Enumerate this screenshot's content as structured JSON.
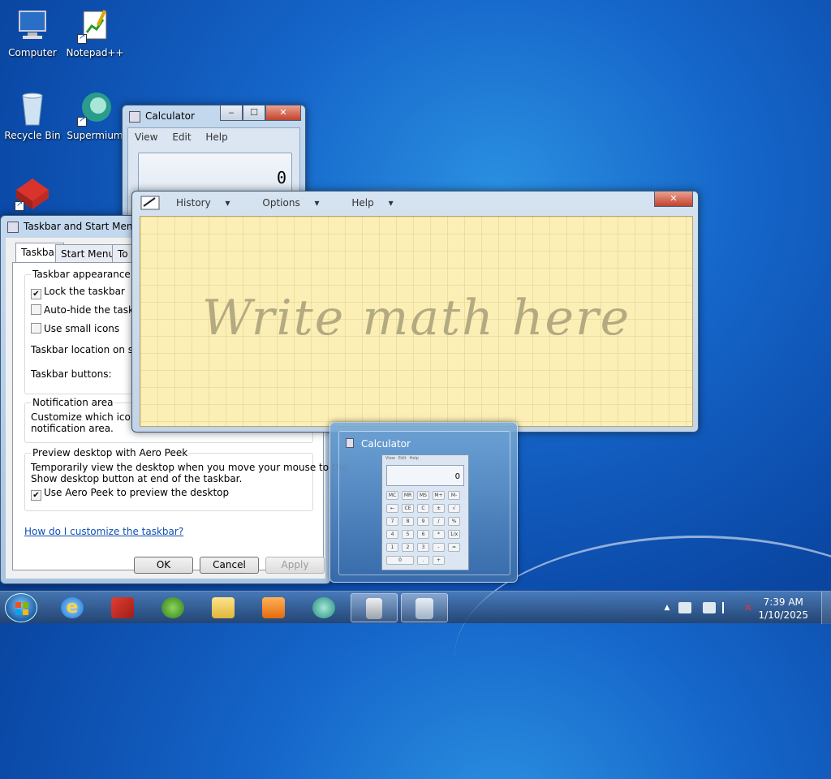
{
  "desktop_icons": [
    {
      "label": "Computer",
      "icon": "computer-icon"
    },
    {
      "label": "Notepad++",
      "icon": "notepad-plus-plus-icon"
    },
    {
      "label": "Recycle Bin",
      "icon": "recycle-bin-icon"
    },
    {
      "label": "Supermium",
      "icon": "supermium-icon"
    }
  ],
  "calculator": {
    "title": "Calculator",
    "menu": [
      "View",
      "Edit",
      "Help"
    ],
    "display": "0",
    "min_label": "‒",
    "max_label": "☐",
    "close_label": "✕"
  },
  "taskbar_dialog": {
    "title": "Taskbar and Start Menu",
    "tabs": [
      "Taskbar",
      "Start Menu",
      "To"
    ],
    "appearance_group": "Taskbar appearance",
    "lock_taskbar": "Lock the taskbar",
    "autohide": "Auto-hide the taskba",
    "small_icons": "Use small icons",
    "location": "Taskbar location on scre",
    "buttons": "Taskbar buttons:",
    "notification_group": "Notification area",
    "notification_text": "Customize which icons and\nnotification area.",
    "aero_group": "Preview desktop with Aero Peek",
    "aero_text": "Temporarily view the desktop when you move your mouse to the\nShow desktop button at end of the taskbar.",
    "aero_check": "Use Aero Peek to preview the desktop",
    "help_link": "How do I customize the taskbar?",
    "ok": "OK",
    "cancel": "Cancel",
    "apply": "Apply",
    "checks": {
      "lock": "✔",
      "autohide": "",
      "small": "",
      "aero": "✔"
    }
  },
  "math_panel": {
    "menu_history": "History",
    "menu_options": "Options",
    "menu_help": "Help",
    "arrow": "▾",
    "placeholder": "Write math here",
    "close_label": "✕"
  },
  "thumbnail": {
    "title": "Calculator",
    "mini_menu": [
      "View",
      "Edit",
      "Help"
    ],
    "mini_display": "0",
    "keys": [
      "MC",
      "MR",
      "MS",
      "M+",
      "M-",
      "←",
      "CE",
      "C",
      "±",
      "√",
      "7",
      "8",
      "9",
      "/",
      "%",
      "4",
      "5",
      "6",
      "*",
      "1/x",
      "1",
      "2",
      "3",
      "-",
      "=",
      "0",
      ".",
      "+"
    ]
  },
  "taskbar": {
    "apps": [
      {
        "name": "start-button",
        "icon": "windows-logo-icon"
      },
      {
        "name": "internet-explorer",
        "icon": "internet-explorer-icon"
      },
      {
        "name": "app-red",
        "icon": "red-cube-icon"
      },
      {
        "name": "download-manager",
        "icon": "globe-arrow-icon"
      },
      {
        "name": "file-explorer",
        "icon": "folder-icon"
      },
      {
        "name": "media-player",
        "icon": "media-player-icon"
      },
      {
        "name": "supermium",
        "icon": "supermium-icon"
      },
      {
        "name": "computer-properties",
        "icon": "computer-tower-icon"
      },
      {
        "name": "calculator",
        "icon": "calculator-icon"
      }
    ],
    "time": "7:39 AM",
    "date": "1/10/2025",
    "tray_arrow": "▲"
  }
}
